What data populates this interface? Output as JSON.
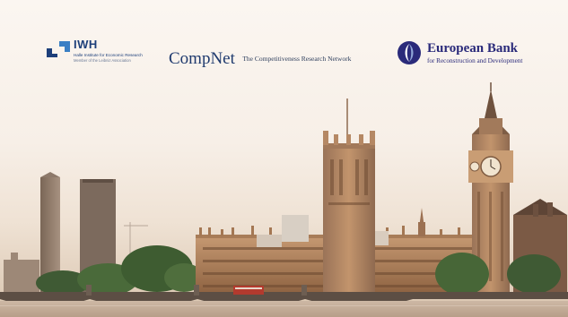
{
  "logos": {
    "iwh": {
      "name": "IWH",
      "line1": "Halle Institute for Economic Research",
      "line2": "Member of the Leibniz Association",
      "color": "#1d3f7a"
    },
    "compnet": {
      "name": "CompNet",
      "tagline": "The Competitiveness Research Network",
      "color": "#1f3a6e"
    },
    "ebrd": {
      "name": "European Bank",
      "subtitle": "for Reconstruction and Development",
      "color": "#2a2a7a"
    }
  },
  "background": {
    "scene": "london-skyline-icon",
    "tone": "#e9d8c6"
  }
}
